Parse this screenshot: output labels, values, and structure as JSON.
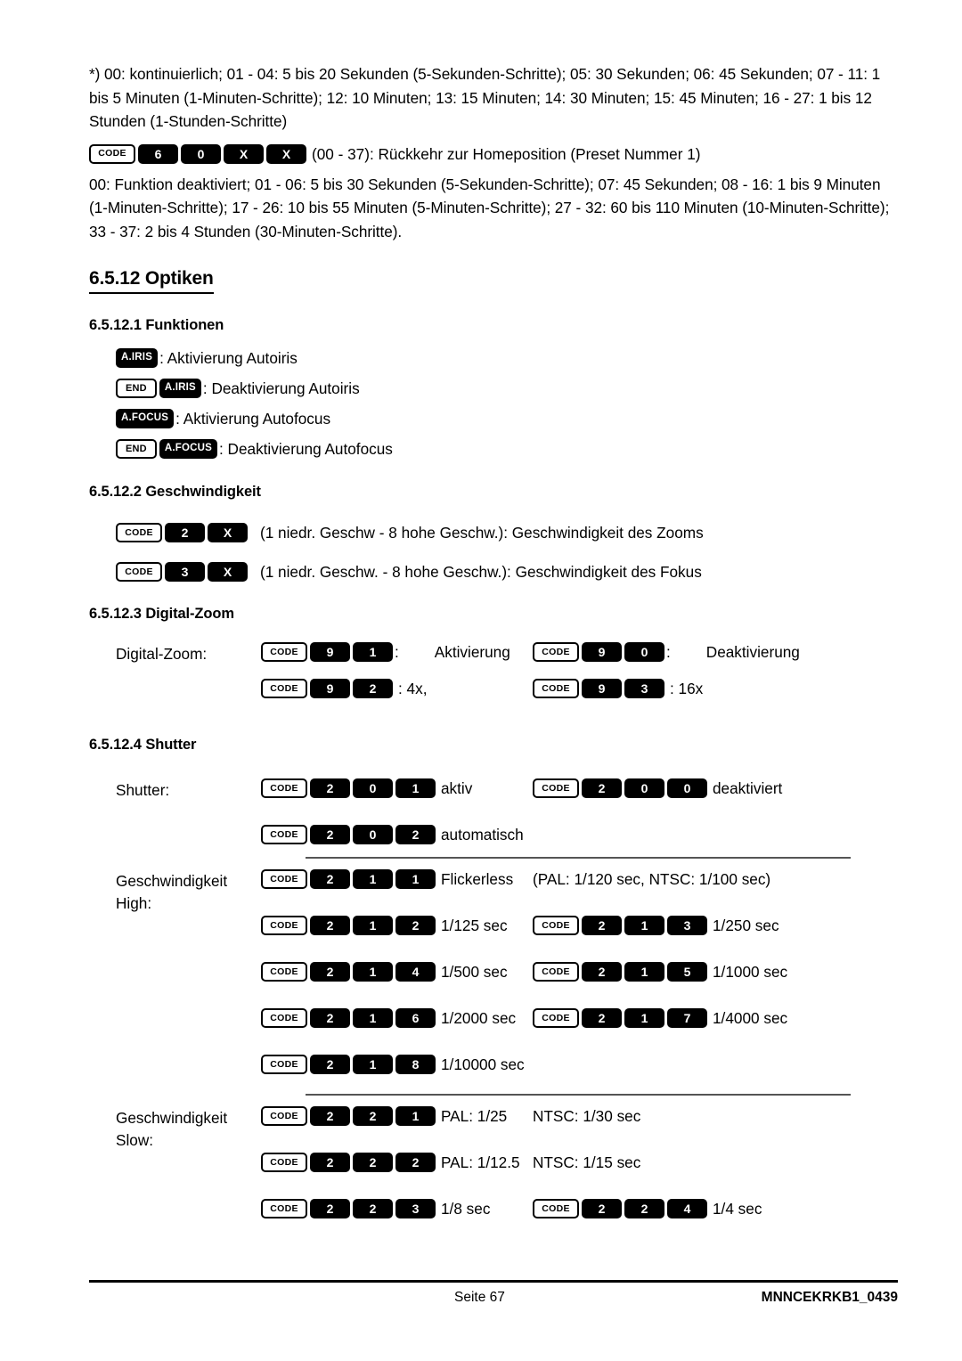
{
  "document": {
    "page_label": "Seite 67",
    "doc_code": "MNNCEKRKB1_0439"
  },
  "intro": {
    "footnote": "*) 00: kontinuierlich; 01 - 04: 5 bis 20 Sekunden (5-Sekunden-Schritte); 05: 30 Sekunden; 06: 45 Sekunden; 07 - 11: 1 bis 5 Minuten (1-Minuten-Schritte); 12: 10 Minuten; 13: 15 Minuten; 14: 30 Minuten; 15: 45 Minuten; 16 - 27: 1 bis 12 Stunden (1-Stunden-Schritte)",
    "home_keys": [
      "CODE",
      "6",
      "0",
      "X",
      "X"
    ],
    "home_text": "(00 - 37): Rückkehr zur Homeposition (Preset Nummer 1)",
    "home_detail": "00: Funktion deaktiviert; 01 - 06: 5 bis 30 Sekunden (5-Sekunden-Schritte); 07: 45 Sekunden; 08 - 16: 1 bis 9 Minuten (1-Minuten-Schritte); 17 - 26: 10 bis 55 Minuten (5-Minuten-Schritte); 27 - 32: 60 bis 110 Minuten (10-Minuten-Schritte); 33 - 37: 2 bis 4 Stunden (30-Minuten-Schritte)."
  },
  "section": {
    "number": "6.5.12",
    "title": "6.5.12 Optiken"
  },
  "funktionen": {
    "heading": "6.5.12.1 Funktionen",
    "rows": [
      {
        "keys": [
          "A.IRIS"
        ],
        "text": ": Aktivierung Autoiris"
      },
      {
        "keys": [
          "END",
          "A.IRIS"
        ],
        "text": ": Deaktivierung Autoiris"
      },
      {
        "keys": [
          "A.FOCUS"
        ],
        "text": ": Aktivierung Autofocus"
      },
      {
        "keys": [
          "END",
          "A.FOCUS"
        ],
        "text": ": Deaktivierung Autofocus"
      }
    ]
  },
  "geschwindigkeit": {
    "heading": "6.5.12.2 Geschwindigkeit",
    "rows": [
      {
        "keys": [
          "CODE",
          "2",
          "X"
        ],
        "text": "(1 niedr. Geschw - 8 hohe Geschw.): Geschwindigkeit des Zooms"
      },
      {
        "keys": [
          "CODE",
          "3",
          "X"
        ],
        "text": "(1 niedr. Geschw. - 8 hohe Geschw.): Geschwindigkeit des Fokus"
      }
    ]
  },
  "digitalzoom": {
    "heading": "6.5.12.3 Digital-Zoom",
    "label": "Digital-Zoom:",
    "rows": [
      {
        "left_keys": [
          "CODE",
          "9",
          "1"
        ],
        "left_text": ":",
        "left_desc": "Aktivierung",
        "right_keys": [
          "CODE",
          "9",
          "0"
        ],
        "right_text": ":",
        "right_desc": "Deaktivierung"
      },
      {
        "left_keys": [
          "CODE",
          "9",
          "2"
        ],
        "left_text": ": 4x,",
        "left_desc": "",
        "right_keys": [
          "CODE",
          "9",
          "3"
        ],
        "right_text": ": 16x",
        "right_desc": ""
      }
    ]
  },
  "shutter": {
    "heading": "6.5.12.4 Shutter",
    "label_shutter": "Shutter:",
    "label_high": "Geschwindigkeit High:",
    "label_high_line1": "Geschwindigkeit",
    "label_high_line2": "High:",
    "label_slow_line1": "Geschwindigkeit",
    "label_slow_line2": "Slow:",
    "mode_rows": [
      {
        "left_keys": [
          "CODE",
          "2",
          "0",
          "1"
        ],
        "left_text": "aktiv",
        "right_keys": [
          "CODE",
          "2",
          "0",
          "0"
        ],
        "right_text": "deaktiviert"
      },
      {
        "left_keys": [
          "CODE",
          "2",
          "0",
          "2"
        ],
        "left_text": "automatisch",
        "right_keys": [],
        "right_text": ""
      }
    ],
    "high_rows": [
      {
        "left_keys": [
          "CODE",
          "2",
          "1",
          "1"
        ],
        "left_text": "Flickerless",
        "right_keys": [],
        "right_text": "(PAL: 1/120 sec, NTSC: 1/100 sec)"
      },
      {
        "left_keys": [
          "CODE",
          "2",
          "1",
          "2"
        ],
        "left_text": "1/125 sec",
        "right_keys": [
          "CODE",
          "2",
          "1",
          "3"
        ],
        "right_text": "1/250 sec"
      },
      {
        "left_keys": [
          "CODE",
          "2",
          "1",
          "4"
        ],
        "left_text": "1/500 sec",
        "right_keys": [
          "CODE",
          "2",
          "1",
          "5"
        ],
        "right_text": "1/1000 sec"
      },
      {
        "left_keys": [
          "CODE",
          "2",
          "1",
          "6"
        ],
        "left_text": "1/2000 sec",
        "right_keys": [
          "CODE",
          "2",
          "1",
          "7"
        ],
        "right_text": "1/4000 sec"
      },
      {
        "left_keys": [
          "CODE",
          "2",
          "1",
          "8"
        ],
        "left_text": "1/10000 sec",
        "right_keys": [],
        "right_text": ""
      }
    ],
    "slow_rows": [
      {
        "left_keys": [
          "CODE",
          "2",
          "2",
          "1"
        ],
        "left_text": "PAL: 1/25",
        "right_keys": [],
        "right_text": "NTSC: 1/30 sec"
      },
      {
        "left_keys": [
          "CODE",
          "2",
          "2",
          "2"
        ],
        "left_text": "PAL: 1/12.5",
        "right_keys": [],
        "right_text": "NTSC: 1/15 sec"
      },
      {
        "left_keys": [
          "CODE",
          "2",
          "2",
          "3"
        ],
        "left_text": "1/8 sec",
        "right_keys": [
          "CODE",
          "2",
          "2",
          "4"
        ],
        "right_text": "1/4 sec"
      }
    ]
  },
  "colors": {
    "key_dark_bg": "#000000",
    "key_dark_fg": "#ffffff",
    "key_light_bg": "#ffffff",
    "key_light_fg": "#000000",
    "rule": "#555555",
    "page_bg": "#ffffff",
    "text": "#000000"
  }
}
